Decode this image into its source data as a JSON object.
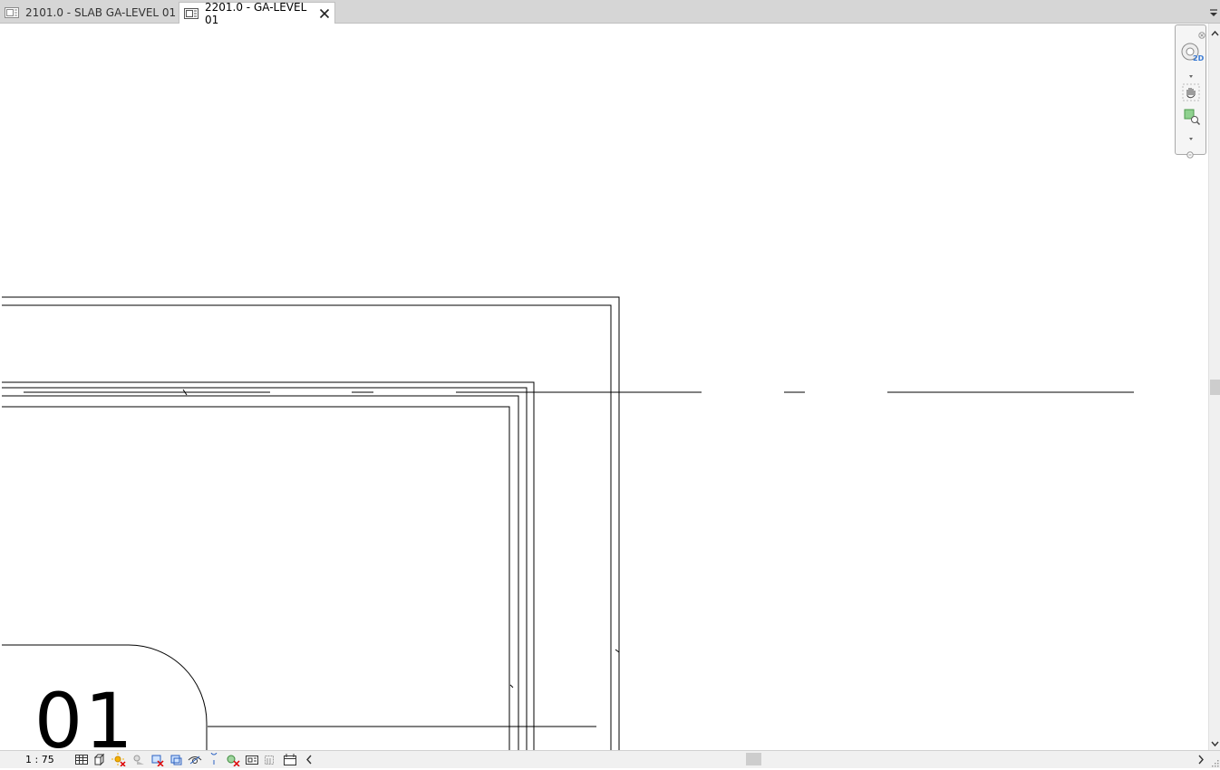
{
  "tabs": [
    {
      "label": "2101.0 - SLAB GA-LEVEL 01",
      "icon": "sheet-icon",
      "active": false
    },
    {
      "label": "2201.0 - GA-LEVEL 01",
      "icon": "sheet-icon",
      "active": true
    }
  ],
  "drawing": {
    "visible_text": "' 01"
  },
  "navigation_bar": {
    "wheel_badge": "2D",
    "items": [
      "steering-wheel-icon",
      "pan-icon",
      "zoom-region-icon"
    ]
  },
  "status_bar": {
    "scale": "1 : 75",
    "view_controls": [
      "detail-level-icon",
      "visual-style-icon",
      "sun-path-icon",
      "shadows-icon",
      "crop-view-icon",
      "show-crop-region-icon",
      "temporary-hide-isolate-icon",
      "reveal-hidden-icon",
      "worksharing-icon",
      "analytical-model-icon",
      "highlight-displacement-icon",
      "temporary-view-properties-icon",
      "constraints-icon"
    ]
  },
  "colors": {
    "tab_bar": "#d6d6d6",
    "active_tab": "#ffffff",
    "canvas": "#ffffff",
    "line": "#000000"
  }
}
